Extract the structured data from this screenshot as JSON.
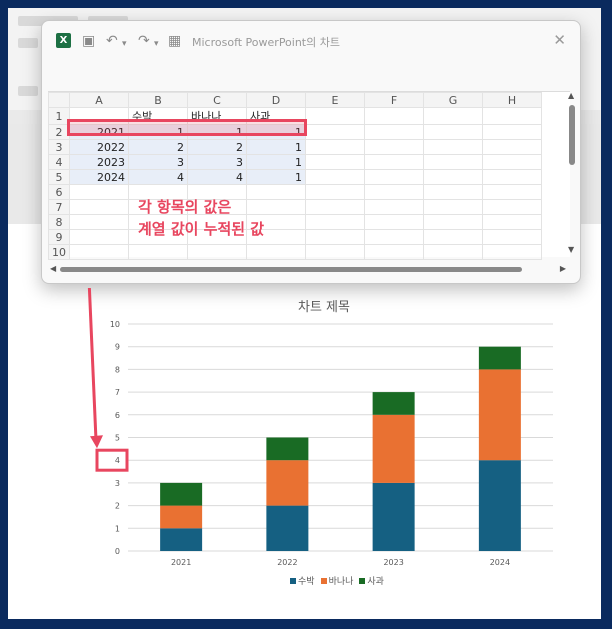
{
  "window": {
    "title": "Microsoft PowerPoint의 차트",
    "close_glyph": "✕"
  },
  "sheet": {
    "columns": [
      "A",
      "B",
      "C",
      "D",
      "E",
      "F",
      "G",
      "H"
    ],
    "row_numbers": [
      "1",
      "2",
      "3",
      "4",
      "5",
      "6",
      "7",
      "8",
      "9",
      "10"
    ],
    "header_row": [
      "",
      "수박",
      "바나나",
      "사과"
    ],
    "rows": [
      [
        "2021",
        "1",
        "1",
        "1"
      ],
      [
        "2022",
        "2",
        "2",
        "1"
      ],
      [
        "2023",
        "3",
        "3",
        "1"
      ],
      [
        "2024",
        "4",
        "4",
        "1"
      ]
    ]
  },
  "annotation": {
    "line1": "각 항목의 값은",
    "line2": "계열 값이 누적된 값"
  },
  "colors": {
    "accent_red": "#e8465f",
    "series_watermelon": "#156082",
    "series_banana": "#e97132",
    "series_apple": "#196b24"
  },
  "chart_data": {
    "type": "bar",
    "stacked": true,
    "title": "차트 제목",
    "categories": [
      "2021",
      "2022",
      "2023",
      "2024"
    ],
    "series": [
      {
        "name": "수박",
        "values": [
          1,
          2,
          3,
          4
        ]
      },
      {
        "name": "바나나",
        "values": [
          1,
          2,
          3,
          4
        ]
      },
      {
        "name": "사과",
        "values": [
          1,
          1,
          1,
          1
        ]
      }
    ],
    "ylim": [
      0,
      10
    ],
    "yticks": [
      "0",
      "1",
      "2",
      "3",
      "4",
      "5",
      "6",
      "7",
      "8",
      "9",
      "10"
    ],
    "grid": true,
    "legend": "bottom",
    "highlighted_tick": "4"
  }
}
